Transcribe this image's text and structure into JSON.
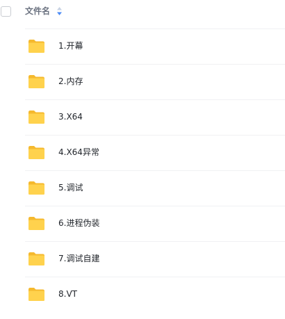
{
  "header": {
    "column_title": "文件名",
    "sort_icon": "sort-updown-icon"
  },
  "files": [
    {
      "name": "1.开幕",
      "icon": "folder-icon"
    },
    {
      "name": "2.内存",
      "icon": "folder-icon"
    },
    {
      "name": "3.X64",
      "icon": "folder-icon"
    },
    {
      "name": "4.X64异常",
      "icon": "folder-icon"
    },
    {
      "name": "5.调试",
      "icon": "folder-icon"
    },
    {
      "name": "6.进程伪装",
      "icon": "folder-icon"
    },
    {
      "name": "7.调试自建",
      "icon": "folder-icon"
    },
    {
      "name": "8.VT",
      "icon": "folder-icon"
    }
  ],
  "colors": {
    "folder_front": "#ffd24d",
    "folder_back": "#f5b92e",
    "sort_active": "#4c8bf5",
    "sort_inactive": "#c7d2e3"
  }
}
